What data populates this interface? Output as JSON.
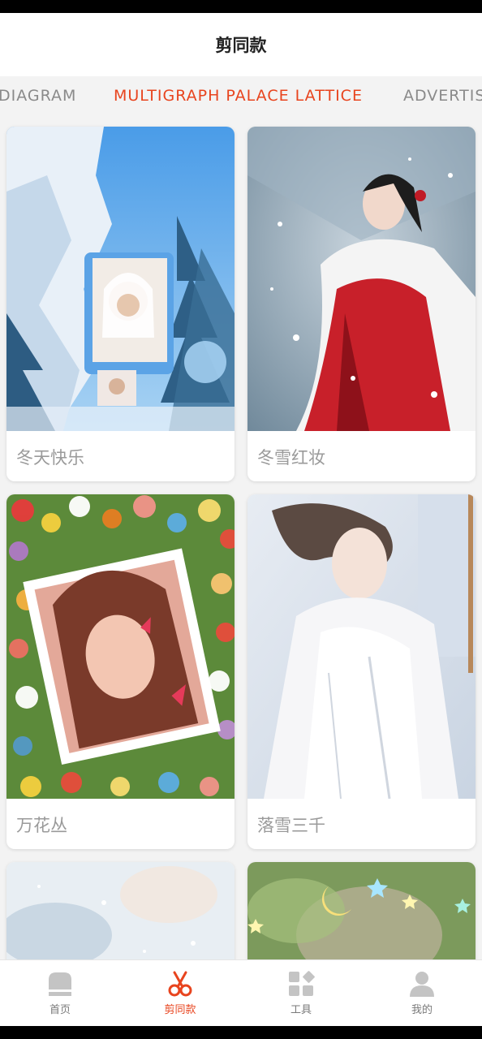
{
  "header": {
    "title": "剪同款"
  },
  "category_tabs": [
    {
      "label": "DIAGRAM",
      "active": false
    },
    {
      "label": "MULTIGRAPH PALACE LATTICE",
      "active": true
    },
    {
      "label": "ADVERTIS",
      "active": false
    }
  ],
  "templates": [
    {
      "title": "冬天快乐"
    },
    {
      "title": "冬雪红妆"
    },
    {
      "title": "万花丛"
    },
    {
      "title": "落雪三千"
    },
    {
      "title": ""
    },
    {
      "title": ""
    }
  ],
  "bottom_nav": [
    {
      "label": "首页",
      "icon": "home-icon",
      "active": false
    },
    {
      "label": "剪同款",
      "icon": "scissors-icon",
      "active": true
    },
    {
      "label": "工具",
      "icon": "tools-grid-icon",
      "active": false
    },
    {
      "label": "我的",
      "icon": "profile-icon",
      "active": false
    }
  ],
  "colors": {
    "accent": "#e8441e",
    "inactive": "#8a8a8a",
    "background": "#f3f3f3"
  }
}
